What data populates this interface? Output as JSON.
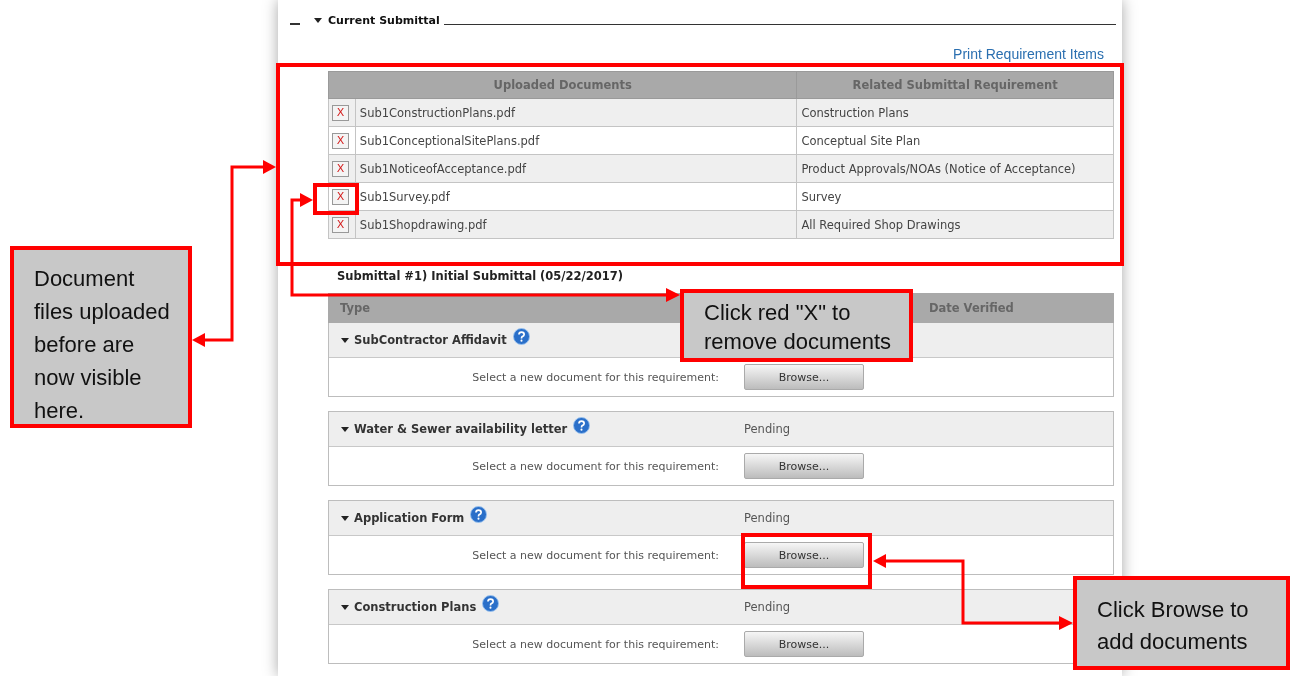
{
  "section": {
    "title": "Current Submittal",
    "expanded": true
  },
  "print_link": "Print Requirement Items",
  "documents": {
    "columns": [
      "Uploaded Documents",
      "Related Submittal Requirement"
    ],
    "rows": [
      {
        "remove": "X",
        "file": "Sub1ConstructionPlans.pdf",
        "requirement": "Construction Plans"
      },
      {
        "remove": "X",
        "file": "Sub1ConceptionalSitePlans.pdf",
        "requirement": "Conceptual Site Plan"
      },
      {
        "remove": "X",
        "file": "Sub1NoticeofAcceptance.pdf",
        "requirement": "Product Approvals/NOAs (Notice of Acceptance)"
      },
      {
        "remove": "X",
        "file": "Sub1Survey.pdf",
        "requirement": "Survey"
      },
      {
        "remove": "X",
        "file": "Sub1Shopdrawing.pdf",
        "requirement": "All Required Shop Drawings"
      }
    ]
  },
  "submittal": {
    "title": "Submittal #1) Initial Submittal (05/22/2017)",
    "columns": [
      "Type",
      "Date Verified"
    ],
    "requirements": [
      {
        "name": "SubContractor Affidavit",
        "expanded": true,
        "prompt": "Select a new document for this requirement:",
        "button": "Browse..."
      },
      {
        "name": "Water & Sewer availability letter",
        "expanded": true,
        "status": "Pending",
        "prompt": "Select a new document for this requirement:",
        "button": "Browse..."
      },
      {
        "name": "Application Form",
        "expanded": true,
        "status": "Pending",
        "prompt": "Select a new document for this requirement:",
        "button": "Browse..."
      },
      {
        "name": "Construction Plans",
        "expanded": true,
        "status": "Pending",
        "prompt": "Select a new document for this requirement:",
        "button": "Browse..."
      }
    ]
  },
  "callouts": [
    {
      "text": "Document files uploaded before are now visible here."
    },
    {
      "text": "Click red \"X\" to remove documents"
    },
    {
      "text": "Click Browse to add documents"
    }
  ]
}
